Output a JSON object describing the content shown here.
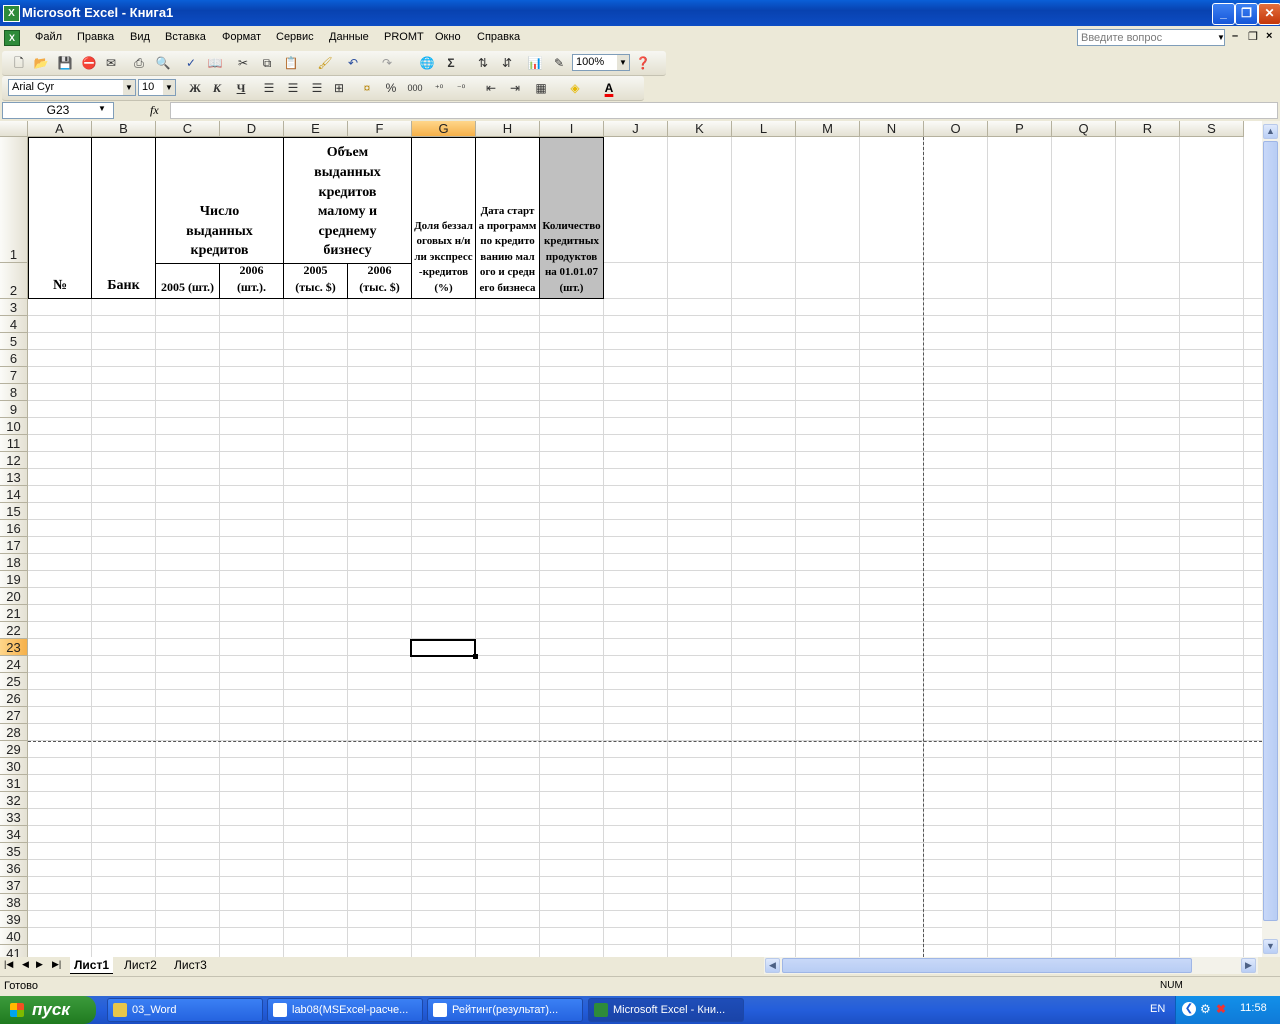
{
  "window": {
    "title": "Microsoft Excel - Книга1"
  },
  "menu": [
    "Файл",
    "Правка",
    "Вид",
    "Вставка",
    "Формат",
    "Сервис",
    "Данные",
    "PROMT",
    "Окно",
    "Справка"
  ],
  "help_placeholder": "Введите вопрос",
  "toolbar": {
    "zoom": "100%",
    "font": "Arial Cyr",
    "size": "10",
    "bold": "Ж",
    "italic": "К",
    "underline": "Ч",
    "sigma": "Σ",
    "percent": "%",
    "thousands": "000"
  },
  "formula": {
    "namebox": "G23",
    "fx": "fx"
  },
  "columns": [
    "A",
    "B",
    "C",
    "D",
    "E",
    "F",
    "G",
    "H",
    "I",
    "J",
    "K",
    "L",
    "M",
    "N",
    "O",
    "P",
    "Q",
    "R",
    "S"
  ],
  "selected": {
    "column": "G",
    "row": "23"
  },
  "rows": [
    "1",
    "2",
    "3",
    "4",
    "5",
    "6",
    "7",
    "8",
    "9",
    "10",
    "11",
    "12",
    "13",
    "14",
    "15",
    "16",
    "17",
    "18",
    "19",
    "20",
    "21",
    "22",
    "23",
    "24",
    "25",
    "26",
    "27",
    "28",
    "29",
    "30",
    "31",
    "32",
    "33",
    "34",
    "35",
    "36",
    "37",
    "38",
    "39",
    "40",
    "41"
  ],
  "table_header": {
    "num": "№",
    "bank": "Банк",
    "count_loans": "Число выданных кредитов",
    "count_2005": "2005 (шт.)",
    "count_2006": "2006 (шт.).",
    "volume": "Объем выданных кредитов малому и среднему бизнесу",
    "vol_2005": "2005 (тыс. $)",
    "vol_2006": "2006 (тыс. $)",
    "share": "Доля беззалоговых н/или экспресс-кредитов (%)",
    "start_date": "Дата старта программ по кредитованию малого и среднего бизнеса",
    "products": "Количество кредитных продуктов на 01.01.07 (шт.)"
  },
  "sheets": [
    "Лист1",
    "Лист2",
    "Лист3"
  ],
  "status": {
    "ready": "Готово",
    "num": "NUM"
  },
  "taskbar": {
    "start": "пуск",
    "tasks": [
      "03_Word",
      "lab08(MSExcel-расче...",
      "Рейтинг(результат)...",
      "Microsoft Excel - Кни..."
    ],
    "lang": "EN",
    "clock": "11:58"
  }
}
